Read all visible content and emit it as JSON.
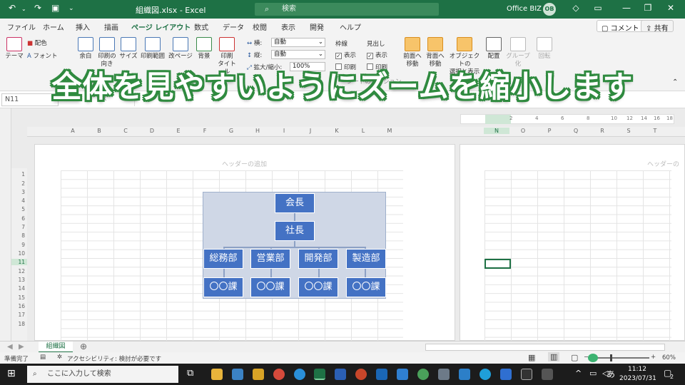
{
  "titlebar": {
    "filename": "組織図.xlsx",
    "separator": "-",
    "app": "Excel",
    "search_placeholder": "検索",
    "user_name": "Office BIZ",
    "user_initials": "OB",
    "accent_color": "#1e7145"
  },
  "tabs": [
    "ファイル",
    "ホーム",
    "挿入",
    "描画",
    "ページ レイアウト",
    "数式",
    "データ",
    "校閲",
    "表示",
    "開発",
    "ヘルプ"
  ],
  "active_tab": "ページ レイアウト",
  "comments_button": "コメント",
  "share_button": "共有",
  "ribbon": {
    "theme": "テーマ",
    "colors": "配色",
    "fonts": "フォント",
    "margins": "余白",
    "orientation_1": "印刷の",
    "orientation_2": "向き",
    "size": "サイズ",
    "print_area": "印刷範囲",
    "breaks": "改ページ",
    "background": "背景",
    "print_titles_1": "印刷",
    "print_titles_2": "タイトル",
    "width_label": "横:",
    "width_value": "自動",
    "height_label": "縦:",
    "height_value": "自動",
    "scale_label": "拡大/縮小:",
    "scale_value": "100%",
    "gridlines_label": "枠線",
    "gridlines_view": "表示",
    "gridlines_print": "印刷",
    "headings_label": "見出し",
    "headings_view": "表示",
    "headings_print": "印刷",
    "bring_forward_1": "前面へ",
    "bring_forward_2": "移動",
    "send_backward_1": "背面へ",
    "send_backward_2": "移動",
    "selection_pane_1": "オブジェクトの",
    "selection_pane_2": "選択と表示",
    "align": "配置",
    "group": "グループ化",
    "rotate": "回転",
    "sheet_options_partial": "シートのオプション"
  },
  "overlay_caption": "全体を見やすいようにズームを縮小します",
  "namebox": "N11",
  "columns_left": [
    "A",
    "B",
    "C",
    "D",
    "E",
    "F",
    "G",
    "H",
    "I",
    "J",
    "K",
    "L",
    "M"
  ],
  "columns_right": [
    "N",
    "O",
    "P",
    "Q",
    "R",
    "S",
    "T"
  ],
  "rows": [
    "1",
    "2",
    "3",
    "4",
    "5",
    "6",
    "7",
    "8",
    "9",
    "10",
    "11",
    "12",
    "13",
    "14",
    "15",
    "16",
    "17",
    "18"
  ],
  "header_add": "ヘッダーの追加",
  "header_add_partial": "ヘッダーの",
  "ruler_marks": [
    "2",
    "4",
    "6",
    "8",
    "10",
    "12",
    "14",
    "16",
    "18"
  ],
  "org": {
    "chairman": "会長",
    "president": "社長",
    "departments": [
      "総務部",
      "営業部",
      "開発部",
      "製造部"
    ],
    "sections": [
      "〇〇課",
      "〇〇課",
      "〇〇課",
      "〇〇課"
    ],
    "box_color": "#4472c4"
  },
  "sheet_tab": "組織図",
  "status": {
    "ready": "準備完了",
    "accessibility": "アクセシビリティ: 検討が必要です",
    "zoom": "60%"
  },
  "taskbar": {
    "search_placeholder": "ここに入力して検索",
    "time": "11:12",
    "date": "2023/07/31",
    "ime": "あ",
    "notifications": "2"
  }
}
